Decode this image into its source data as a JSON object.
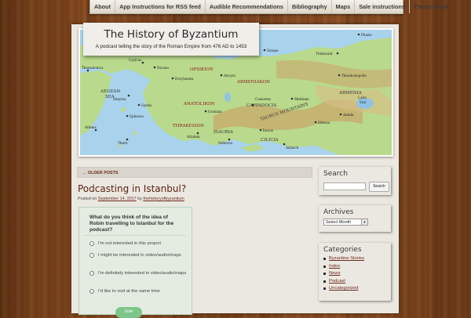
{
  "nav": {
    "items": [
      "About",
      "App Instructions for RSS feed",
      "Audible Recommendations",
      "Bibliography",
      "Maps",
      "Sale instructions",
      "Theme Music"
    ]
  },
  "site": {
    "title": "The History of Byzantium",
    "description": "A podcast telling the story of the Roman Empire from 476 AD to 1453"
  },
  "map": {
    "labels": {
      "aegean": "AEGEAN\nSEA",
      "opsikion": "OPSIKION",
      "armeniakon": "ARMENIAKON",
      "anatolikon": "ANATOLIKON",
      "cappadocia": "CAPPADOCIA",
      "armenia": "ARMENIA",
      "taurus": "TAURUS MOUNTAINS",
      "thrakesion": "THRAKESION",
      "isauria": "ISAURIA",
      "cilicia": "CILICIA",
      "lake_van": "Lake\nVan",
      "phasis": "Phasis",
      "trebizond": "Trebizond",
      "sinope": "Sinope",
      "nicaea": "Nicaea",
      "cyzicus": "Cyzicus",
      "dorylaeum": "Dorylaeum",
      "ancyra": "Ancyra",
      "ephesus": "Ephesus",
      "sardis": "Sardis",
      "smyrna": "Smyrna",
      "iconium": "Iconium",
      "caesarea": "Caesarea",
      "melitene": "Melitene",
      "edessa": "Edessa",
      "theodosiopolis": "Theodosiopolis",
      "amida": "Amida",
      "thessalonica": "Thessalonica",
      "athens": "Athens",
      "thera": "Thera",
      "seleucia": "Seleucia",
      "attaleia": "Attaleia",
      "tarsus": "Tarsus",
      "antioch": "Antioch"
    }
  },
  "content": {
    "older_posts": "← OLDER POSTS",
    "post_title": "Podcasting in Istanbul?",
    "post_meta_prefix": "Posted on",
    "post_date": "September 14, 2017",
    "post_meta_by": "by",
    "post_author": "thehistoryofbyzantium",
    "poll": {
      "question": "What do you think of the idea of Robin travelling to Istanbul for the podcast?",
      "options": [
        "I'm not interested in this project",
        "I might be interested in video/audio/maps",
        "I'm definitely interested in video/audio/maps",
        "I'd like to visit at the same time"
      ],
      "vote_label": "Vote"
    }
  },
  "sidebar": {
    "search": {
      "title": "Search",
      "button": "Search",
      "placeholder": ""
    },
    "archives": {
      "title": "Archives",
      "selected": "Select Month"
    },
    "categories": {
      "title": "Categories",
      "items": [
        "Byzantine Stories",
        "Index",
        "News",
        "Podcast",
        "Uncategorized"
      ]
    }
  },
  "colors": {
    "link": "#6b2b1e",
    "sea": "#a9d3ec",
    "land": "#b9d98c",
    "mountain": "#c9a86a"
  }
}
